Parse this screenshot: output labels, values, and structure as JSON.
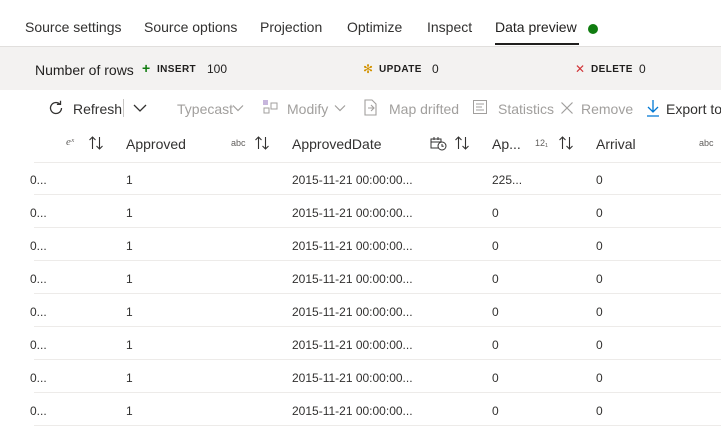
{
  "tabs": [
    {
      "label": "Source settings"
    },
    {
      "label": "Source options"
    },
    {
      "label": "Projection"
    },
    {
      "label": "Optimize"
    },
    {
      "label": "Inspect"
    },
    {
      "label": "Data preview"
    }
  ],
  "status_color": "#107c10",
  "row_stats": {
    "number_of_rows_label": "Number of rows",
    "insert_label": "INSERT",
    "insert_value": "100",
    "update_label": "UPDATE",
    "update_value": "0",
    "delete_label": "DELETE",
    "delete_value": "0",
    "insert_color": "#107c10",
    "update_color": "#d29200",
    "delete_color": "#d13438"
  },
  "toolbar": {
    "refresh": "Refresh",
    "typecast": "Typecast",
    "modify": "Modify",
    "map_drifted": "Map drifted",
    "statistics": "Statistics",
    "remove": "Remove",
    "export": "Export to"
  },
  "columns": [
    {
      "type_badge": "eˣ",
      "label": ""
    },
    {
      "type_badge": "abc",
      "label": "Approved"
    },
    {
      "type_badge": "",
      "label": "ApprovedDate"
    },
    {
      "type_badge": "12₁",
      "label": "Ap..."
    },
    {
      "type_badge": "abc",
      "label": "Arrival"
    }
  ],
  "rows": [
    [
      "0...",
      "1",
      "2015-11-21 00:00:00...",
      "225...",
      "0"
    ],
    [
      "0...",
      "1",
      "2015-11-21 00:00:00...",
      "0",
      "0"
    ],
    [
      "0...",
      "1",
      "2015-11-21 00:00:00...",
      "0",
      "0"
    ],
    [
      "0...",
      "1",
      "2015-11-21 00:00:00...",
      "0",
      "0"
    ],
    [
      "0...",
      "1",
      "2015-11-21 00:00:00...",
      "0",
      "0"
    ],
    [
      "0...",
      "1",
      "2015-11-21 00:00:00...",
      "0",
      "0"
    ],
    [
      "0...",
      "1",
      "2015-11-21 00:00:00...",
      "0",
      "0"
    ],
    [
      "0...",
      "1",
      "2015-11-21 00:00:00...",
      "0",
      "0"
    ]
  ]
}
